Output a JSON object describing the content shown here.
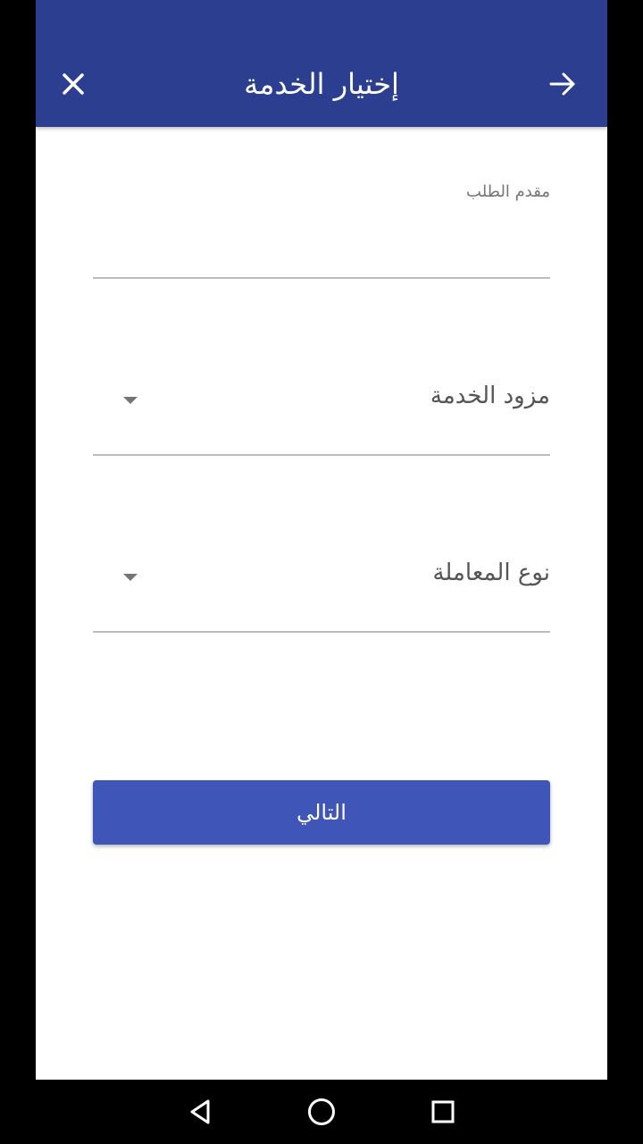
{
  "appbar": {
    "title": "إختيار الخدمة",
    "close_icon": "close-icon",
    "back_icon": "arrow-right-icon",
    "background": "#2c3e8f"
  },
  "form": {
    "applicant_label": "مقدم الطلب",
    "applicant_value": "",
    "provider_label": "مزود الخدمة",
    "transaction_type_label": "نوع المعاملة"
  },
  "actions": {
    "next_label": "التالي",
    "button_color": "#3f55b8"
  },
  "system_nav": {
    "back_icon": "triangle-back-icon",
    "home_icon": "circle-home-icon",
    "recent_icon": "square-recent-icon"
  }
}
